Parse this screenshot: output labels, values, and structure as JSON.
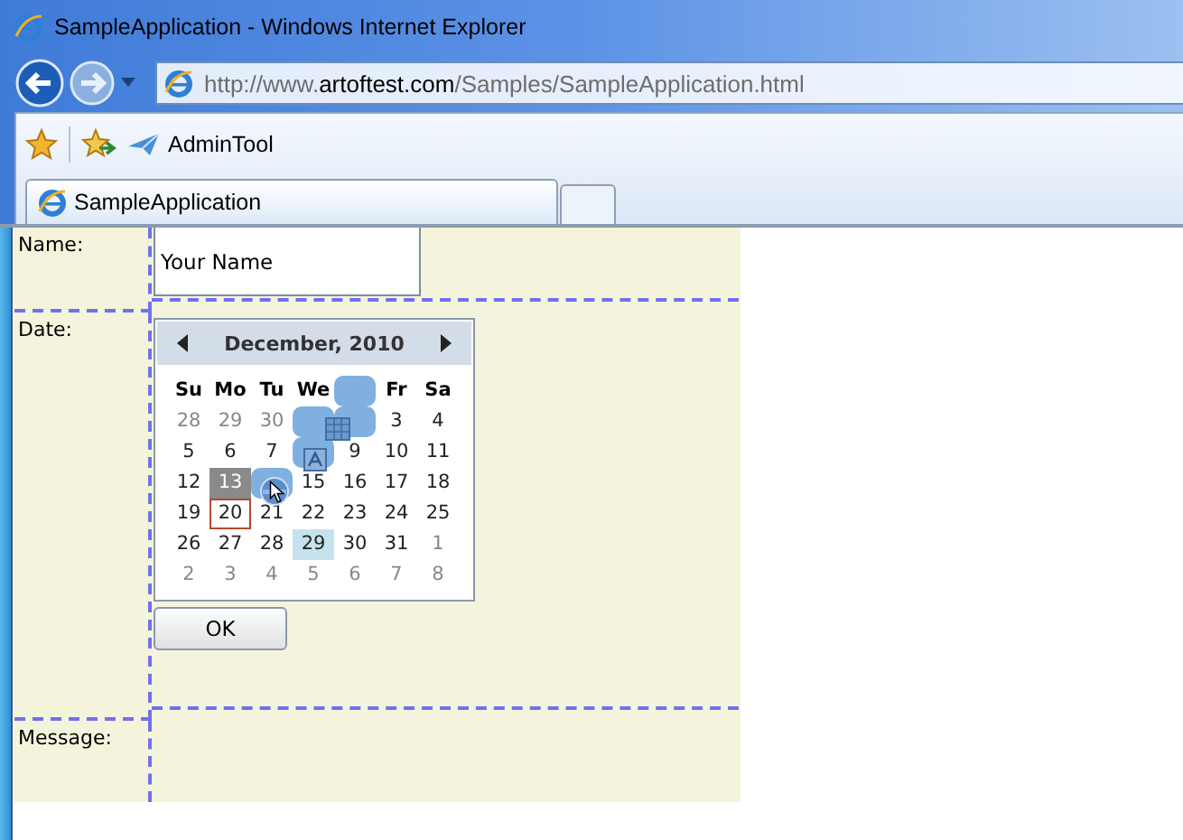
{
  "window": {
    "title": "SampleApplication - Windows Internet Explorer"
  },
  "address": {
    "url": "http://www.**artoftest.com**/Samples/SampleApplication.html"
  },
  "favorites": [
    {
      "label": "AdminTool"
    }
  ],
  "tabs": [
    {
      "label": "SampleApplication",
      "selected": true
    }
  ],
  "form": [
    {
      "kind": "text",
      "label": "Name:",
      "value": "Your Name"
    },
    {
      "kind": "calendar",
      "label": "Date:"
    },
    {
      "kind": "empty",
      "label": "Message:"
    }
  ],
  "calendar": {
    "title": "December, 2010",
    "day_names": [
      {
        "text": "Su",
        "covered": false
      },
      {
        "text": "Mo",
        "covered": false
      },
      {
        "text": "Tu",
        "covered": false
      },
      {
        "text": "We",
        "covered": false
      },
      {
        "covered": true
      },
      {
        "text": "Fr",
        "covered": false
      },
      {
        "text": "Sa",
        "covered": false
      }
    ],
    "weeks": [
      [
        {
          "text": "28",
          "kind": "other",
          "selected": false,
          "today": false,
          "hovered": false,
          "covered": false
        },
        {
          "text": "29",
          "kind": "other",
          "selected": false,
          "today": false,
          "hovered": false,
          "covered": false
        },
        {
          "text": "30",
          "kind": "other",
          "selected": false,
          "today": false,
          "hovered": false,
          "covered": false
        },
        {
          "covered": true
        },
        {
          "covered": true
        },
        {
          "text": "3",
          "kind": "current",
          "selected": false,
          "today": false,
          "hovered": false,
          "covered": false
        },
        {
          "text": "4",
          "kind": "current",
          "selected": false,
          "today": false,
          "hovered": false,
          "covered": false
        }
      ],
      [
        {
          "text": "5",
          "kind": "current",
          "selected": false,
          "today": false,
          "hovered": false,
          "covered": false
        },
        {
          "text": "6",
          "kind": "current",
          "selected": false,
          "today": false,
          "hovered": false,
          "covered": false
        },
        {
          "text": "7",
          "kind": "current",
          "selected": false,
          "today": false,
          "hovered": false,
          "covered": false
        },
        {
          "covered": true
        },
        {
          "text": "9",
          "kind": "current",
          "selected": false,
          "today": false,
          "hovered": false,
          "covered": false
        },
        {
          "text": "10",
          "kind": "current",
          "selected": false,
          "today": false,
          "hovered": false,
          "covered": false
        },
        {
          "text": "11",
          "kind": "current",
          "selected": false,
          "today": false,
          "hovered": false,
          "covered": false
        }
      ],
      [
        {
          "text": "12",
          "kind": "current",
          "selected": false,
          "today": false,
          "hovered": false,
          "covered": false
        },
        {
          "text": "13",
          "kind": "current",
          "selected": true,
          "today": false,
          "hovered": false,
          "covered": false
        },
        {
          "covered": true
        },
        {
          "text": "15",
          "kind": "current",
          "selected": false,
          "today": false,
          "hovered": false,
          "covered": false
        },
        {
          "text": "16",
          "kind": "current",
          "selected": false,
          "today": false,
          "hovered": false,
          "covered": false
        },
        {
          "text": "17",
          "kind": "current",
          "selected": false,
          "today": false,
          "hovered": false,
          "covered": false
        },
        {
          "text": "18",
          "kind": "current",
          "selected": false,
          "today": false,
          "hovered": false,
          "covered": false
        }
      ],
      [
        {
          "text": "19",
          "kind": "current",
          "selected": false,
          "today": false,
          "hovered": false,
          "covered": false
        },
        {
          "text": "20",
          "kind": "current",
          "selected": false,
          "today": true,
          "hovered": false,
          "covered": false
        },
        {
          "text": "21",
          "kind": "current",
          "selected": false,
          "today": false,
          "hovered": false,
          "covered": false
        },
        {
          "text": "22",
          "kind": "current",
          "selected": false,
          "today": false,
          "hovered": false,
          "covered": false
        },
        {
          "text": "23",
          "kind": "current",
          "selected": false,
          "today": false,
          "hovered": false,
          "covered": false
        },
        {
          "text": "24",
          "kind": "current",
          "selected": false,
          "today": false,
          "hovered": false,
          "covered": false
        },
        {
          "text": "25",
          "kind": "current",
          "selected": false,
          "today": false,
          "hovered": false,
          "covered": false
        }
      ],
      [
        {
          "text": "26",
          "kind": "current",
          "selected": false,
          "today": false,
          "hovered": false,
          "covered": false
        },
        {
          "text": "27",
          "kind": "current",
          "selected": false,
          "today": false,
          "hovered": false,
          "covered": false
        },
        {
          "text": "28",
          "kind": "current",
          "selected": false,
          "today": false,
          "hovered": false,
          "covered": false
        },
        {
          "text": "29",
          "kind": "current",
          "selected": false,
          "today": false,
          "hovered": true,
          "covered": false
        },
        {
          "text": "30",
          "kind": "current",
          "selected": false,
          "today": false,
          "hovered": false,
          "covered": false
        },
        {
          "text": "31",
          "kind": "current",
          "selected": false,
          "today": false,
          "hovered": false,
          "covered": false
        },
        {
          "text": "1",
          "kind": "other",
          "selected": false,
          "today": false,
          "hovered": false,
          "covered": false
        }
      ],
      [
        {
          "text": "2",
          "kind": "other",
          "selected": false,
          "today": false,
          "hovered": false,
          "covered": false
        },
        {
          "text": "3",
          "kind": "other",
          "selected": false,
          "today": false,
          "hovered": false,
          "covered": false
        },
        {
          "text": "4",
          "kind": "other",
          "selected": false,
          "today": false,
          "hovered": false,
          "covered": false
        },
        {
          "text": "5",
          "kind": "other",
          "selected": false,
          "today": false,
          "hovered": false,
          "covered": false
        },
        {
          "text": "6",
          "kind": "other",
          "selected": false,
          "today": false,
          "hovered": false,
          "covered": false
        },
        {
          "text": "7",
          "kind": "other",
          "selected": false,
          "today": false,
          "hovered": false,
          "covered": false
        },
        {
          "text": "8",
          "kind": "other",
          "selected": false,
          "today": false,
          "hovered": false,
          "covered": false
        }
      ]
    ]
  },
  "ok_button": {
    "label": "OK"
  }
}
